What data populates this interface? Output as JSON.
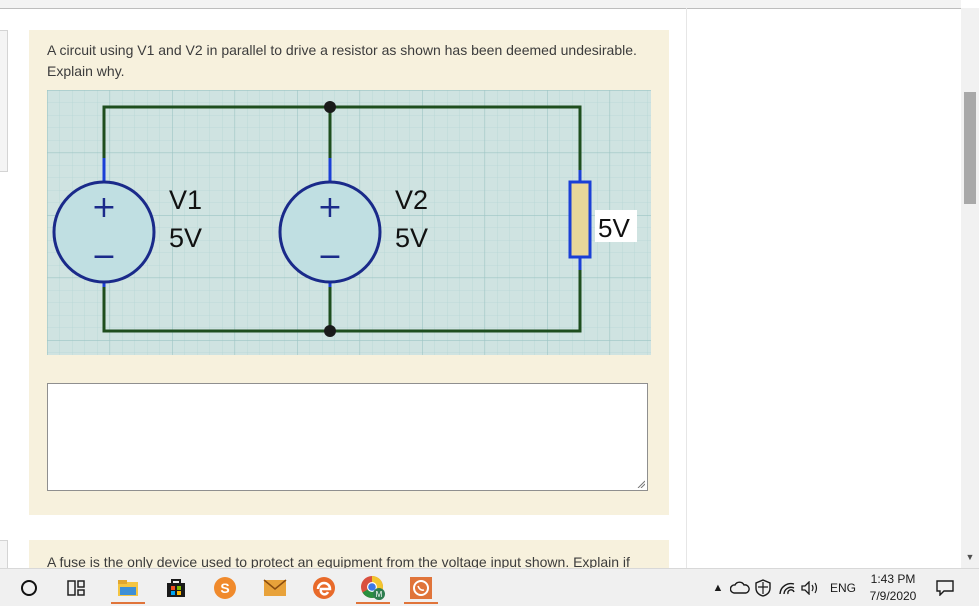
{
  "question1": {
    "text": "A circuit using V1 and V2 in parallel to drive a resistor as shown has been deemed undesirable. Explain why."
  },
  "circuit": {
    "source1_name": "V1",
    "source1_value": "5V",
    "source2_name": "V2",
    "source2_value": "5V",
    "resistor_label": "5V",
    "plus_symbol": "+",
    "minus_symbol": "−"
  },
  "answer_box": {
    "value": ""
  },
  "question2": {
    "text": "A fuse is the only device used to protect an equipment from the voltage input shown. Explain if"
  },
  "taskbar": {
    "start_icon": "cortana-circle-icon",
    "items": [
      "task-view-icon",
      "file-explorer-icon",
      "store-icon",
      "skype-icon",
      "mail-icon",
      "edge-icon",
      "chrome-icon",
      "whatsapp-icon"
    ],
    "chrome_badge": "M",
    "skype_glyph": "S",
    "language": "ENG",
    "time": "1:43 PM",
    "date": "7/9/2020",
    "accent": "#e0743a"
  }
}
